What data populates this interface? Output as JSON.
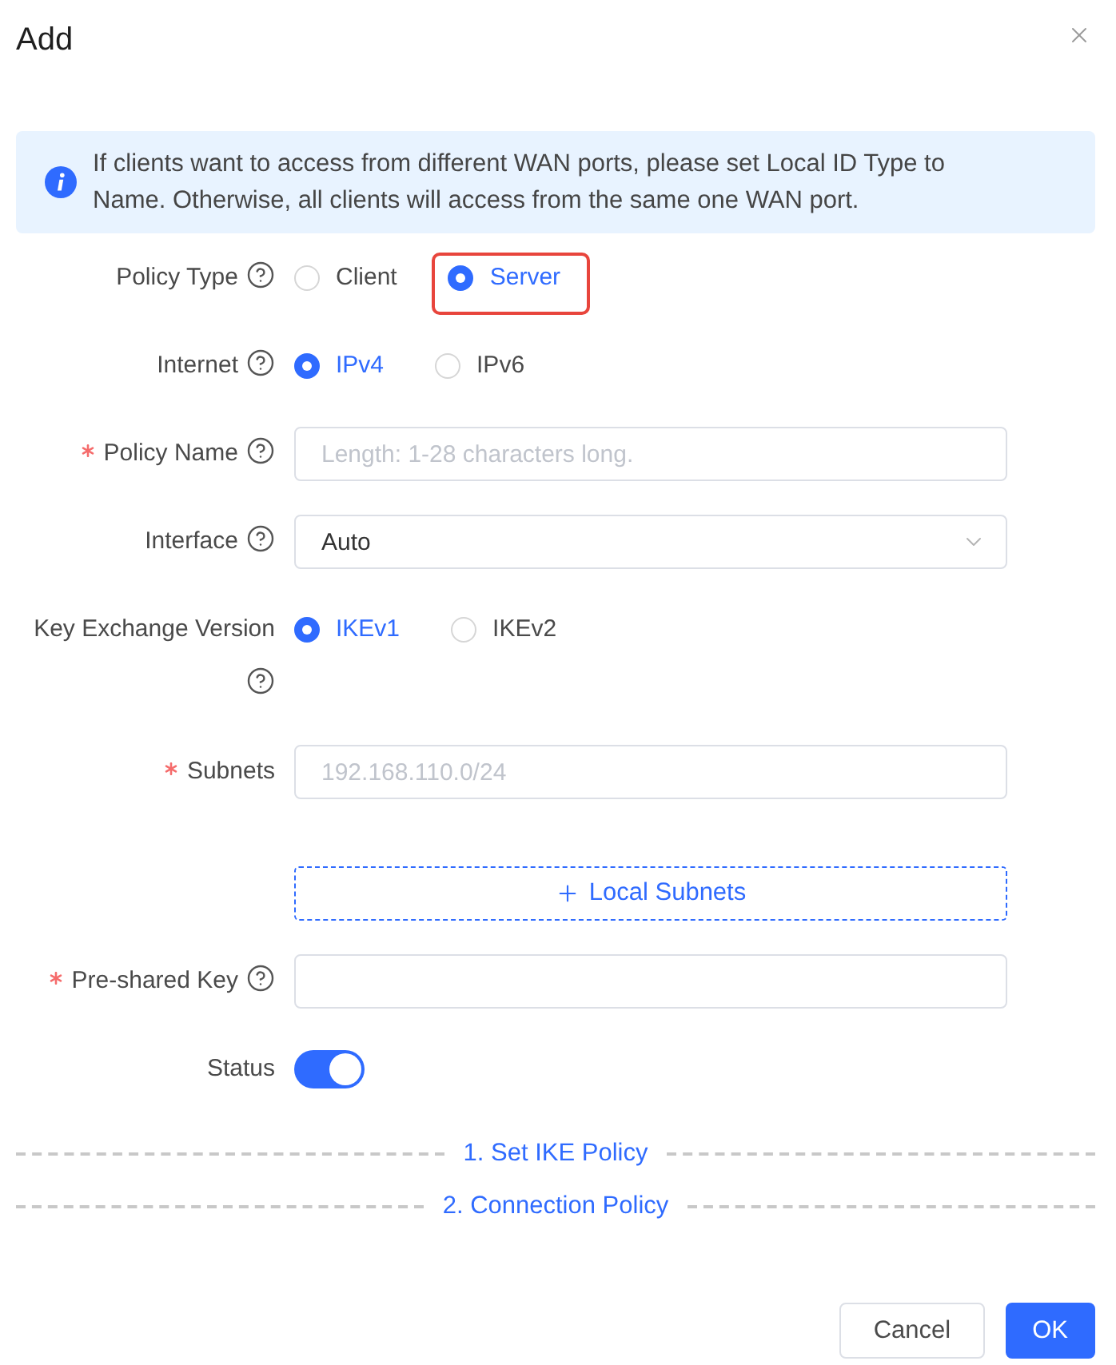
{
  "dialog": {
    "title": "Add"
  },
  "alert": {
    "text": "If clients want to access from different WAN ports, please set Local ID Type to Name. Otherwise, all clients will access from the same one WAN port."
  },
  "fields": [
    {
      "kind": "radio",
      "label": "Policy Type",
      "required": false,
      "help": true,
      "options": [
        {
          "label": "Client",
          "selected": false,
          "highlighted": false
        },
        {
          "label": "Server",
          "selected": true,
          "highlighted": true
        }
      ]
    },
    {
      "kind": "radio",
      "label": "Internet",
      "required": false,
      "help": true,
      "options": [
        {
          "label": "IPv4",
          "selected": true,
          "highlighted": false
        },
        {
          "label": "IPv6",
          "selected": false,
          "highlighted": false
        }
      ]
    },
    {
      "kind": "text",
      "label": "Policy Name",
      "required": true,
      "help": true,
      "placeholder": "Length: 1-28 characters long."
    },
    {
      "kind": "select",
      "label": "Interface",
      "required": false,
      "help": true,
      "value": "Auto"
    },
    {
      "kind": "radio",
      "label": "Key Exchange Version",
      "required": false,
      "help": true,
      "options": [
        {
          "label": "IKEv1",
          "selected": true,
          "highlighted": false
        },
        {
          "label": "IKEv2",
          "selected": false,
          "highlighted": false
        }
      ]
    },
    {
      "kind": "text",
      "label": "Subnets",
      "required": true,
      "help": false,
      "placeholder": "192.168.110.0/24"
    },
    {
      "kind": "add_button",
      "label": "Local Subnets"
    },
    {
      "kind": "text",
      "label": "Pre-shared Key",
      "required": true,
      "help": true
    },
    {
      "kind": "switch",
      "label": "Status",
      "required": false,
      "help": false,
      "on": true
    }
  ],
  "sections": [
    {
      "label": "1. Set IKE Policy"
    },
    {
      "label": "2. Connection Policy"
    }
  ],
  "buttons": [
    {
      "label": "Cancel",
      "kind": "secondary"
    },
    {
      "label": "OK",
      "kind": "primary"
    }
  ]
}
